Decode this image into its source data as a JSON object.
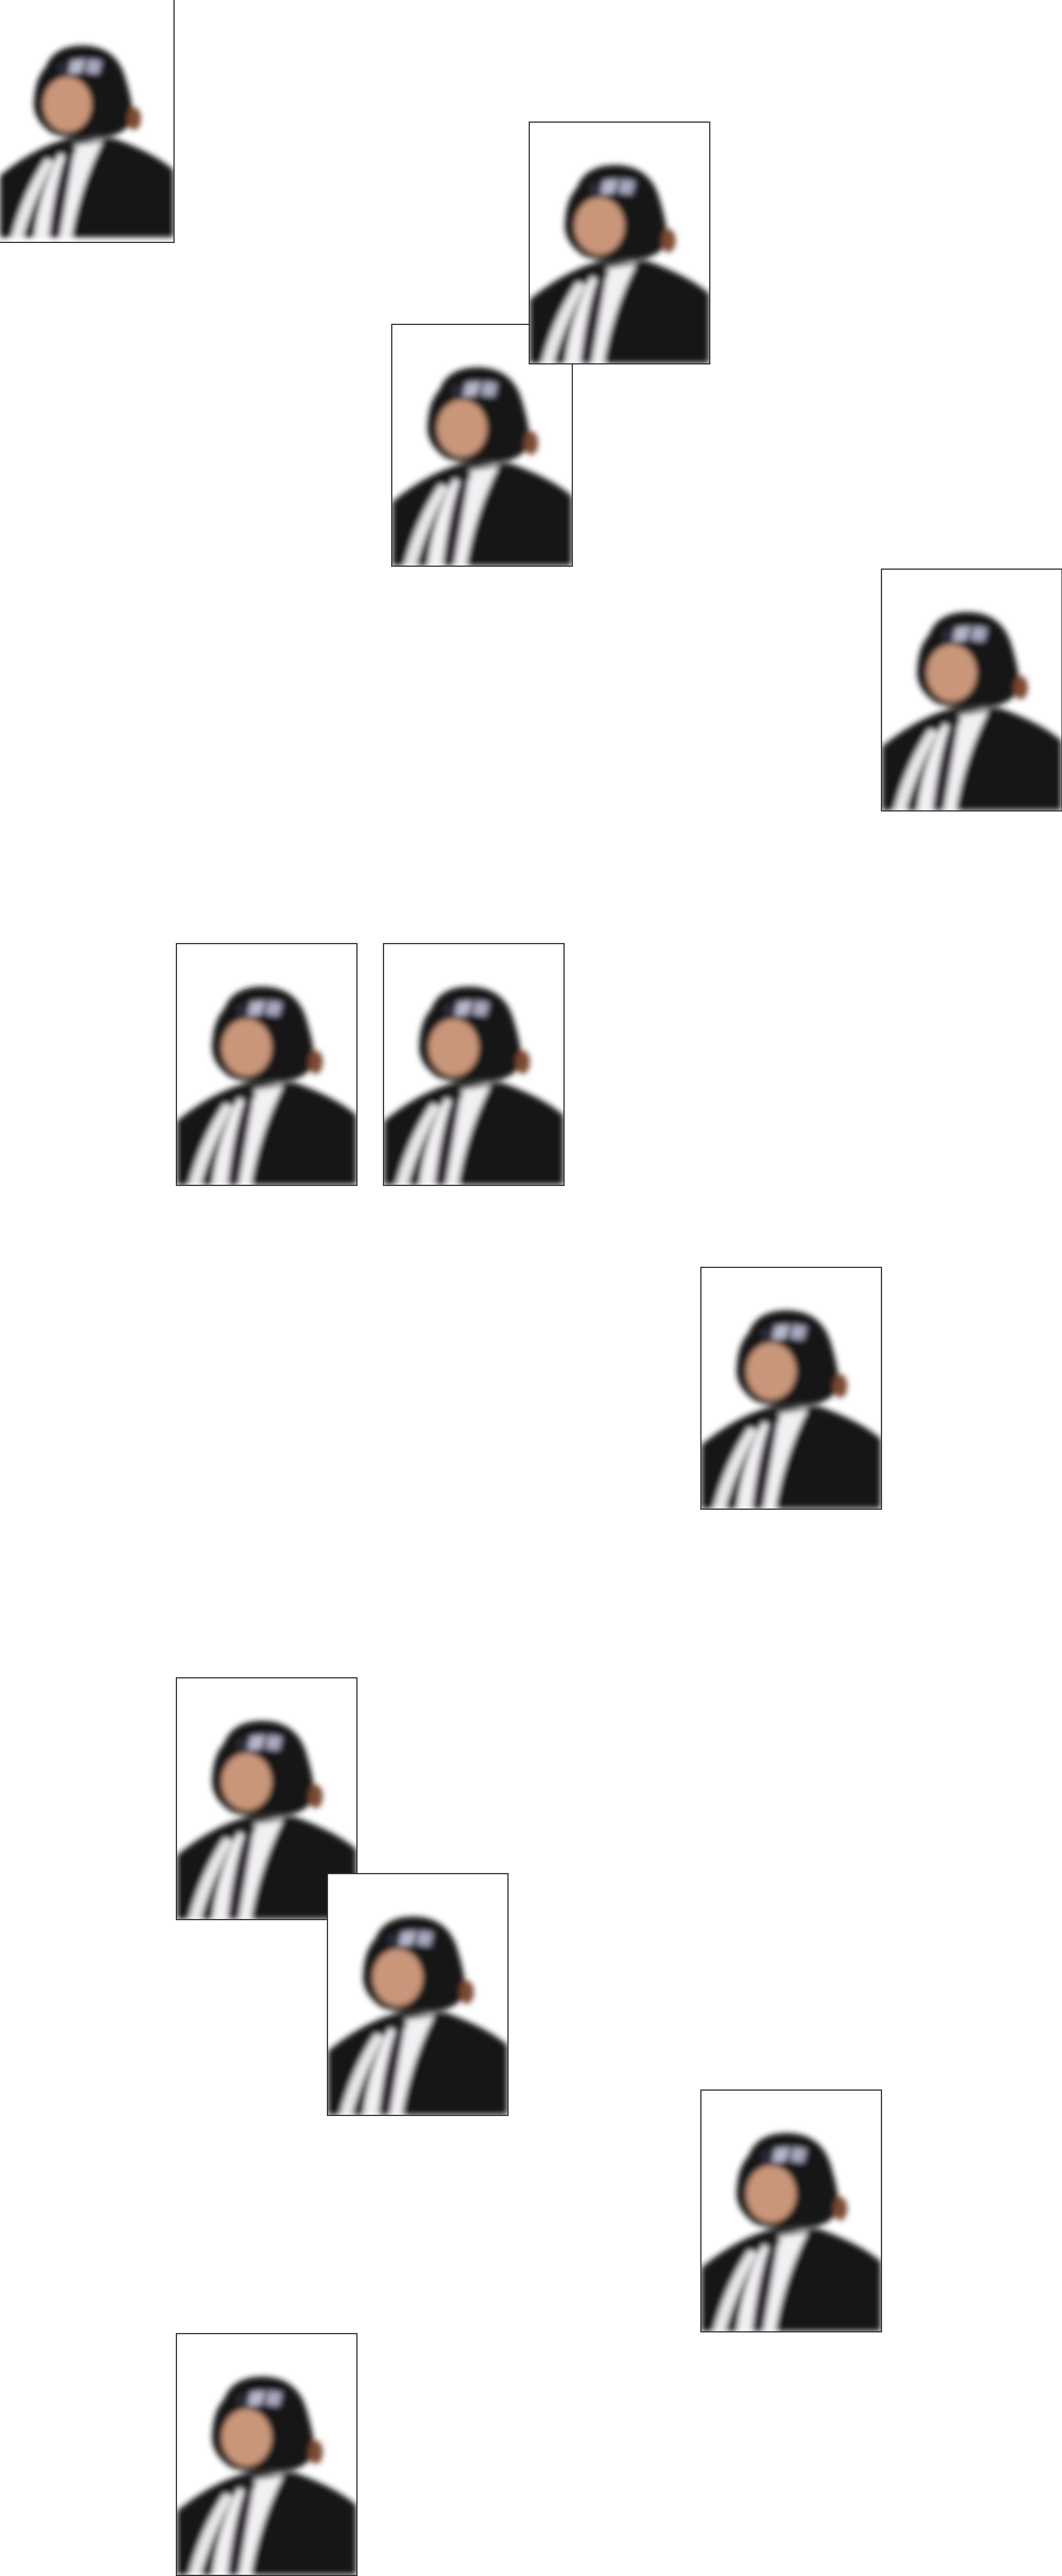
{
  "colors": {
    "background": "#ffffff",
    "frame_border": "#333333",
    "suit": "#151515",
    "shirt": "#f2f0f2",
    "tie": "#2a2433",
    "face": "#c9967a"
  }
}
